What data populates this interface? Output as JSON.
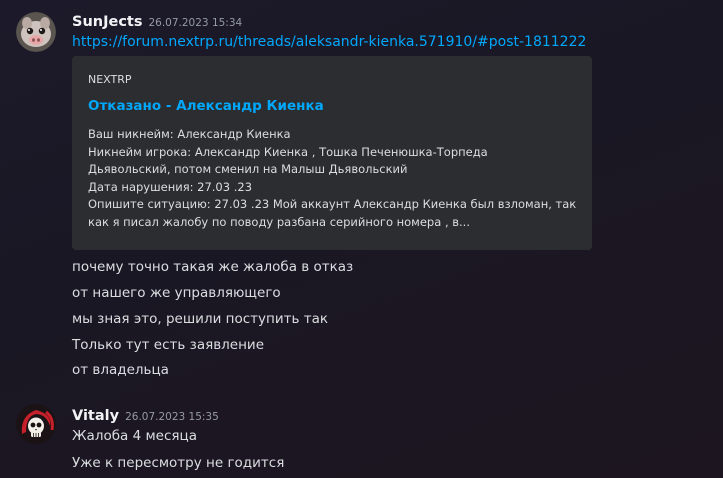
{
  "messages": [
    {
      "author": "SunJects",
      "timestamp": "26.07.2023 15:34",
      "link": "https://forum.nextrp.ru/threads/aleksandr-kienka.571910/#post-1811222",
      "embed": {
        "provider": "NEXTRP",
        "title": "Отказано - Александр Киенка",
        "description_lines": [
          "Ваш никнейм: Александр Киенка",
          "Никнейм игрока: Александр Киенка , Тошка Печенюшка-Торпеда",
          "Дьявольский, потом сменил на Малыш Дьявольский",
          "Дата нарушения: 27.03 .23",
          "Опишите ситуацию: 27.03 .23 Мой аккаунт Александр Киенка был взломан, так",
          "как я писал жалобу по поводу разбана серийного номера , в..."
        ]
      },
      "lines": [
        "почему точно такая же жалоба в отказ",
        "от нашего же управляющего",
        "мы зная это, решили поступить так",
        "Только тут есть заявление",
        "от владельца"
      ]
    },
    {
      "author": "Vitaly",
      "timestamp": "26.07.2023 15:35",
      "lines": [
        "Жалоба 4 месяца",
        "Уже к пересмотру не годится"
      ]
    }
  ],
  "colors": {
    "link": "#00a8fc",
    "text": "#dbdee1",
    "author": "#f2f3f5",
    "muted": "#949ba4",
    "embed_bg": "#2b2d31"
  },
  "icons": {
    "avatar_1": "pig-avatar-icon",
    "avatar_2": "skull-reaper-avatar-icon"
  }
}
